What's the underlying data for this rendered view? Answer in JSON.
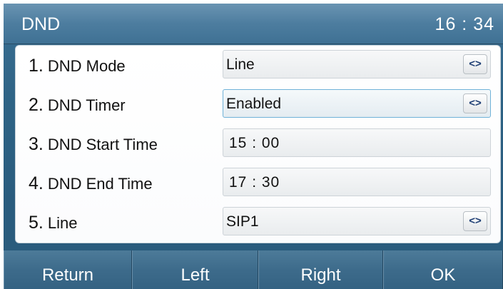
{
  "header": {
    "title": "DND",
    "clock": "16 : 34"
  },
  "rows": [
    {
      "num": "1.",
      "label": "DND Mode",
      "value": "Line",
      "switch": "<>"
    },
    {
      "num": "2.",
      "label": "DND Timer",
      "value": "Enabled",
      "switch": "<>"
    },
    {
      "num": "3.",
      "label": "DND Start Time",
      "value": "15 : 00"
    },
    {
      "num": "4.",
      "label": "DND End Time",
      "value": "17 : 30"
    },
    {
      "num": "5.",
      "label": "Line",
      "value": "SIP1",
      "switch": "<>"
    }
  ],
  "softkeys": [
    "Return",
    "Left",
    "Right",
    "OK"
  ],
  "colors": {
    "background": "#2e6385",
    "title_bar": "#4d7d9f",
    "switch_glyph": "#1d3d73",
    "focus_border": "#6fb2d8"
  }
}
